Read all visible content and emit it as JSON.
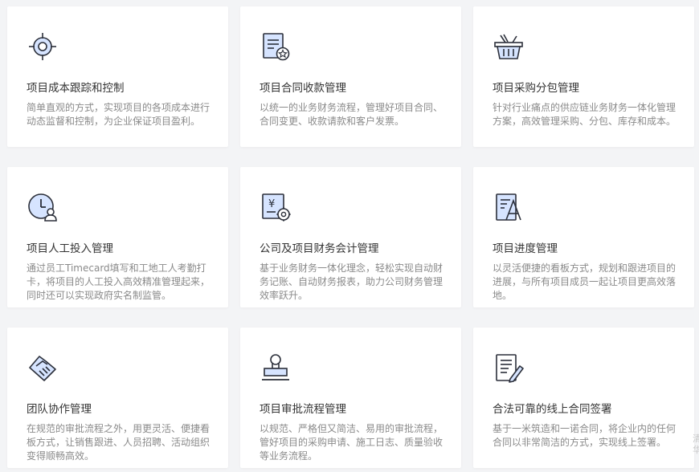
{
  "features": [
    {
      "icon": "target-icon",
      "title": "项目成本跟踪和控制",
      "desc": "简单直观的方式，实现项目的各项成本进行动态监督和控制，为企业保证项目盈利。"
    },
    {
      "icon": "contract-document-icon",
      "title": "项目合同收款管理",
      "desc": "以统一的业务财务流程，管理好项目合同、合同变更、收款请款和客户发票。"
    },
    {
      "icon": "shopping-basket-icon",
      "title": "项目采购分包管理",
      "desc": "针对行业痛点的供应链业务财务一体化管理方案，高效管理采购、分包、库存和成本。"
    },
    {
      "icon": "clock-person-icon",
      "title": "项目人工投入管理",
      "desc": "通过员工Timecard填写和工地工人考勤打卡，将项目的人工投入高效精准管理起来，同时还可以实现政府实名制监管。"
    },
    {
      "icon": "finance-settings-icon",
      "title": "公司及项目财务会计管理",
      "desc": "基于业务财务一体化理念，轻松实现自动财务记账、自动财务报表，助力公司财务管理效率跃升。"
    },
    {
      "icon": "progress-chart-icon",
      "title": "项目进度管理",
      "desc": "以灵活便捷的看板方式，规划和跟进项目的进展，与所有项目成员一起让项目更高效落地。"
    },
    {
      "icon": "handshake-icon",
      "title": "团队协作管理",
      "desc": "在规范的审批流程之外，用更灵活、便捷看板方式，让销售跟进、人员招聘、活动组织变得顺畅高效。"
    },
    {
      "icon": "stamp-icon",
      "title": "项目审批流程管理",
      "desc": "以规范、严格但又简洁、易用的审批流程，管好项目的采购申请、施工日志、质量验收等业务流程。"
    },
    {
      "icon": "document-sign-icon",
      "title": "合法可靠的线上合同签署",
      "desc": "基于一米筑造和一诺合同，将企业内的任何合同以非常简洁的方式，实现线上签署。"
    }
  ],
  "edge_text": "清华"
}
